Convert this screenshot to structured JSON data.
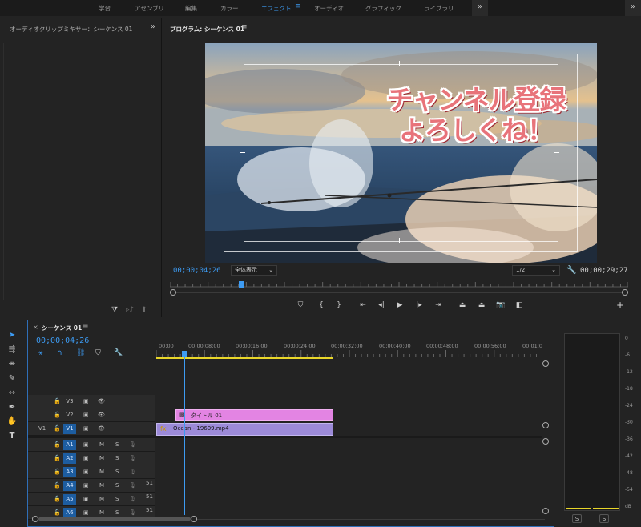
{
  "workspaces": {
    "items": [
      "学習",
      "アセンブリ",
      "編集",
      "カラー",
      "エフェクト",
      "オーディオ",
      "グラフィック",
      "ライブラリ"
    ],
    "active": "エフェクト"
  },
  "mixer": {
    "title": "オーディオクリップミキサー：シーケンス 01"
  },
  "program": {
    "title": "プログラム: シーケンス 01",
    "overlay_line1": "チャンネル登録",
    "overlay_line2": "よろしくね！",
    "current_tc": "00;00;04;26",
    "fit_label": "全体表示",
    "resolution": "1/2",
    "duration_tc": "00;00;29;27",
    "playhead_fraction": 0.155
  },
  "timeline": {
    "title": "シーケンス 01",
    "current_tc": "00;00;04;26",
    "ruler": [
      "00;00",
      "00;00;08;00",
      "00;00;16;00",
      "00;00;24;00",
      "00;00;32;00",
      "00;00;40;00",
      "00;00;48;00",
      "00;00;56;00",
      "00;01;0"
    ],
    "video_tracks": [
      "V3",
      "V2",
      "V1"
    ],
    "source_v": "V1",
    "audio_tracks": [
      "A1",
      "A2",
      "A3",
      "A4",
      "A5",
      "A6"
    ],
    "mute": "M",
    "solo": "S",
    "clips": {
      "title_clip": "タイトル 01",
      "video_clip": "Ocean - 19609.mp4"
    }
  },
  "meters": {
    "scale": [
      "0",
      "-6",
      "-12",
      "-18",
      "-24",
      "-30",
      "-36",
      "-42",
      "-48",
      "-54",
      "dB"
    ],
    "solo_labels": [
      "S",
      "S"
    ]
  },
  "colors": {
    "accent": "#3d9bf2",
    "title_clip": "#e384e3",
    "video_clip": "#9c8ad8",
    "overlay_text": "#e8737a"
  }
}
